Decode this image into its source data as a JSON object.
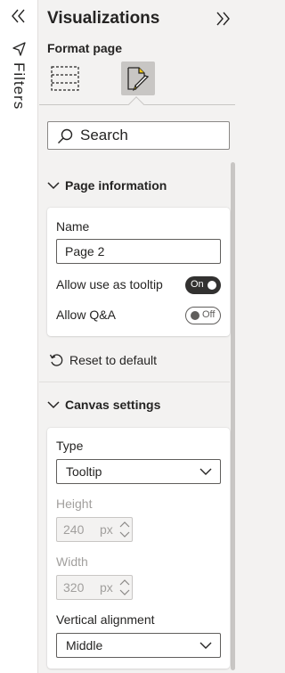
{
  "filters_pane": {
    "label": "Filters",
    "collapse_icon": "double-chevron-left-icon",
    "filter_icon": "filter-funnel-icon"
  },
  "visualizations_pane": {
    "title": "Visualizations",
    "expand_icon": "double-chevron-right-icon",
    "subtitle": "Format page",
    "tabs": [
      {
        "icon": "fields-icon",
        "selected": false
      },
      {
        "icon": "format-paintbrush-icon",
        "selected": true
      }
    ],
    "search": {
      "placeholder": "Search",
      "value": ""
    }
  },
  "page_information": {
    "header": "Page information",
    "expanded": true,
    "name_label": "Name",
    "name_value": "Page 2",
    "tooltip_label": "Allow use as tooltip",
    "tooltip_toggle": "On",
    "qa_label": "Allow Q&A",
    "qa_toggle": "Off",
    "reset_label": "Reset to default"
  },
  "canvas_settings": {
    "header": "Canvas settings",
    "expanded": true,
    "type_label": "Type",
    "type_value": "Tooltip",
    "height_label": "Height",
    "height_value": "240",
    "height_unit": "px",
    "width_label": "Width",
    "width_value": "320",
    "width_unit": "px",
    "valign_label": "Vertical alignment",
    "valign_value": "Middle"
  },
  "colors": {
    "pane_background": "#f3f2f1",
    "card_background": "#ffffff",
    "toggle_on": "#323130",
    "text": "#252423",
    "disabled_text": "#a19f9d"
  }
}
